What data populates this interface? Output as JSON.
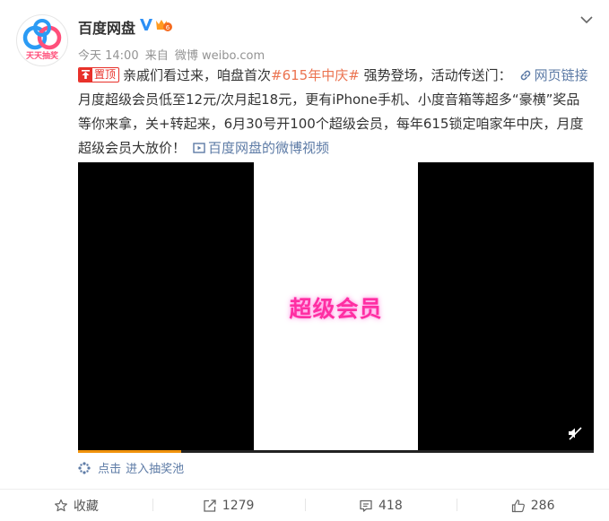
{
  "user": {
    "name": "百度网盘",
    "avatar_text": "天天抽奖"
  },
  "meta": {
    "time": "今天 14:00",
    "from_label": "来自",
    "source": "微博 weibo.com"
  },
  "post": {
    "pin_label": "置顶",
    "text_1": "亲戚们看过来，咱盘首次",
    "topic": "#615年中庆#",
    "text_2": " 强势登场，活动传送门：",
    "web_link_label": "网页链接",
    "text_3": " 月度超级会员低至12元/次月起18元，更有iPhone手机、小度音箱等超多“豪横”奖品等你来拿，关+转起来，6月30号开100个超级会员，每年615锁定咱家年中庆，月度超级会员大放价！",
    "video_link_label": "百度网盘的微博视频"
  },
  "video": {
    "caption": "超级会员",
    "progress": 0.2
  },
  "lottery": {
    "click_label": "点击",
    "pool_label": "进入抽奖池"
  },
  "actions": {
    "favorite_label": "收藏",
    "repost_count": "1279",
    "comment_count": "418",
    "like_count": "286"
  },
  "colors": {
    "accent_orange": "#eb7350",
    "link_blue": "#5d7ba6",
    "pin_red": "#e8312a",
    "caption_pink": "#ff2fa2",
    "progress_orange": "#f0920c"
  }
}
